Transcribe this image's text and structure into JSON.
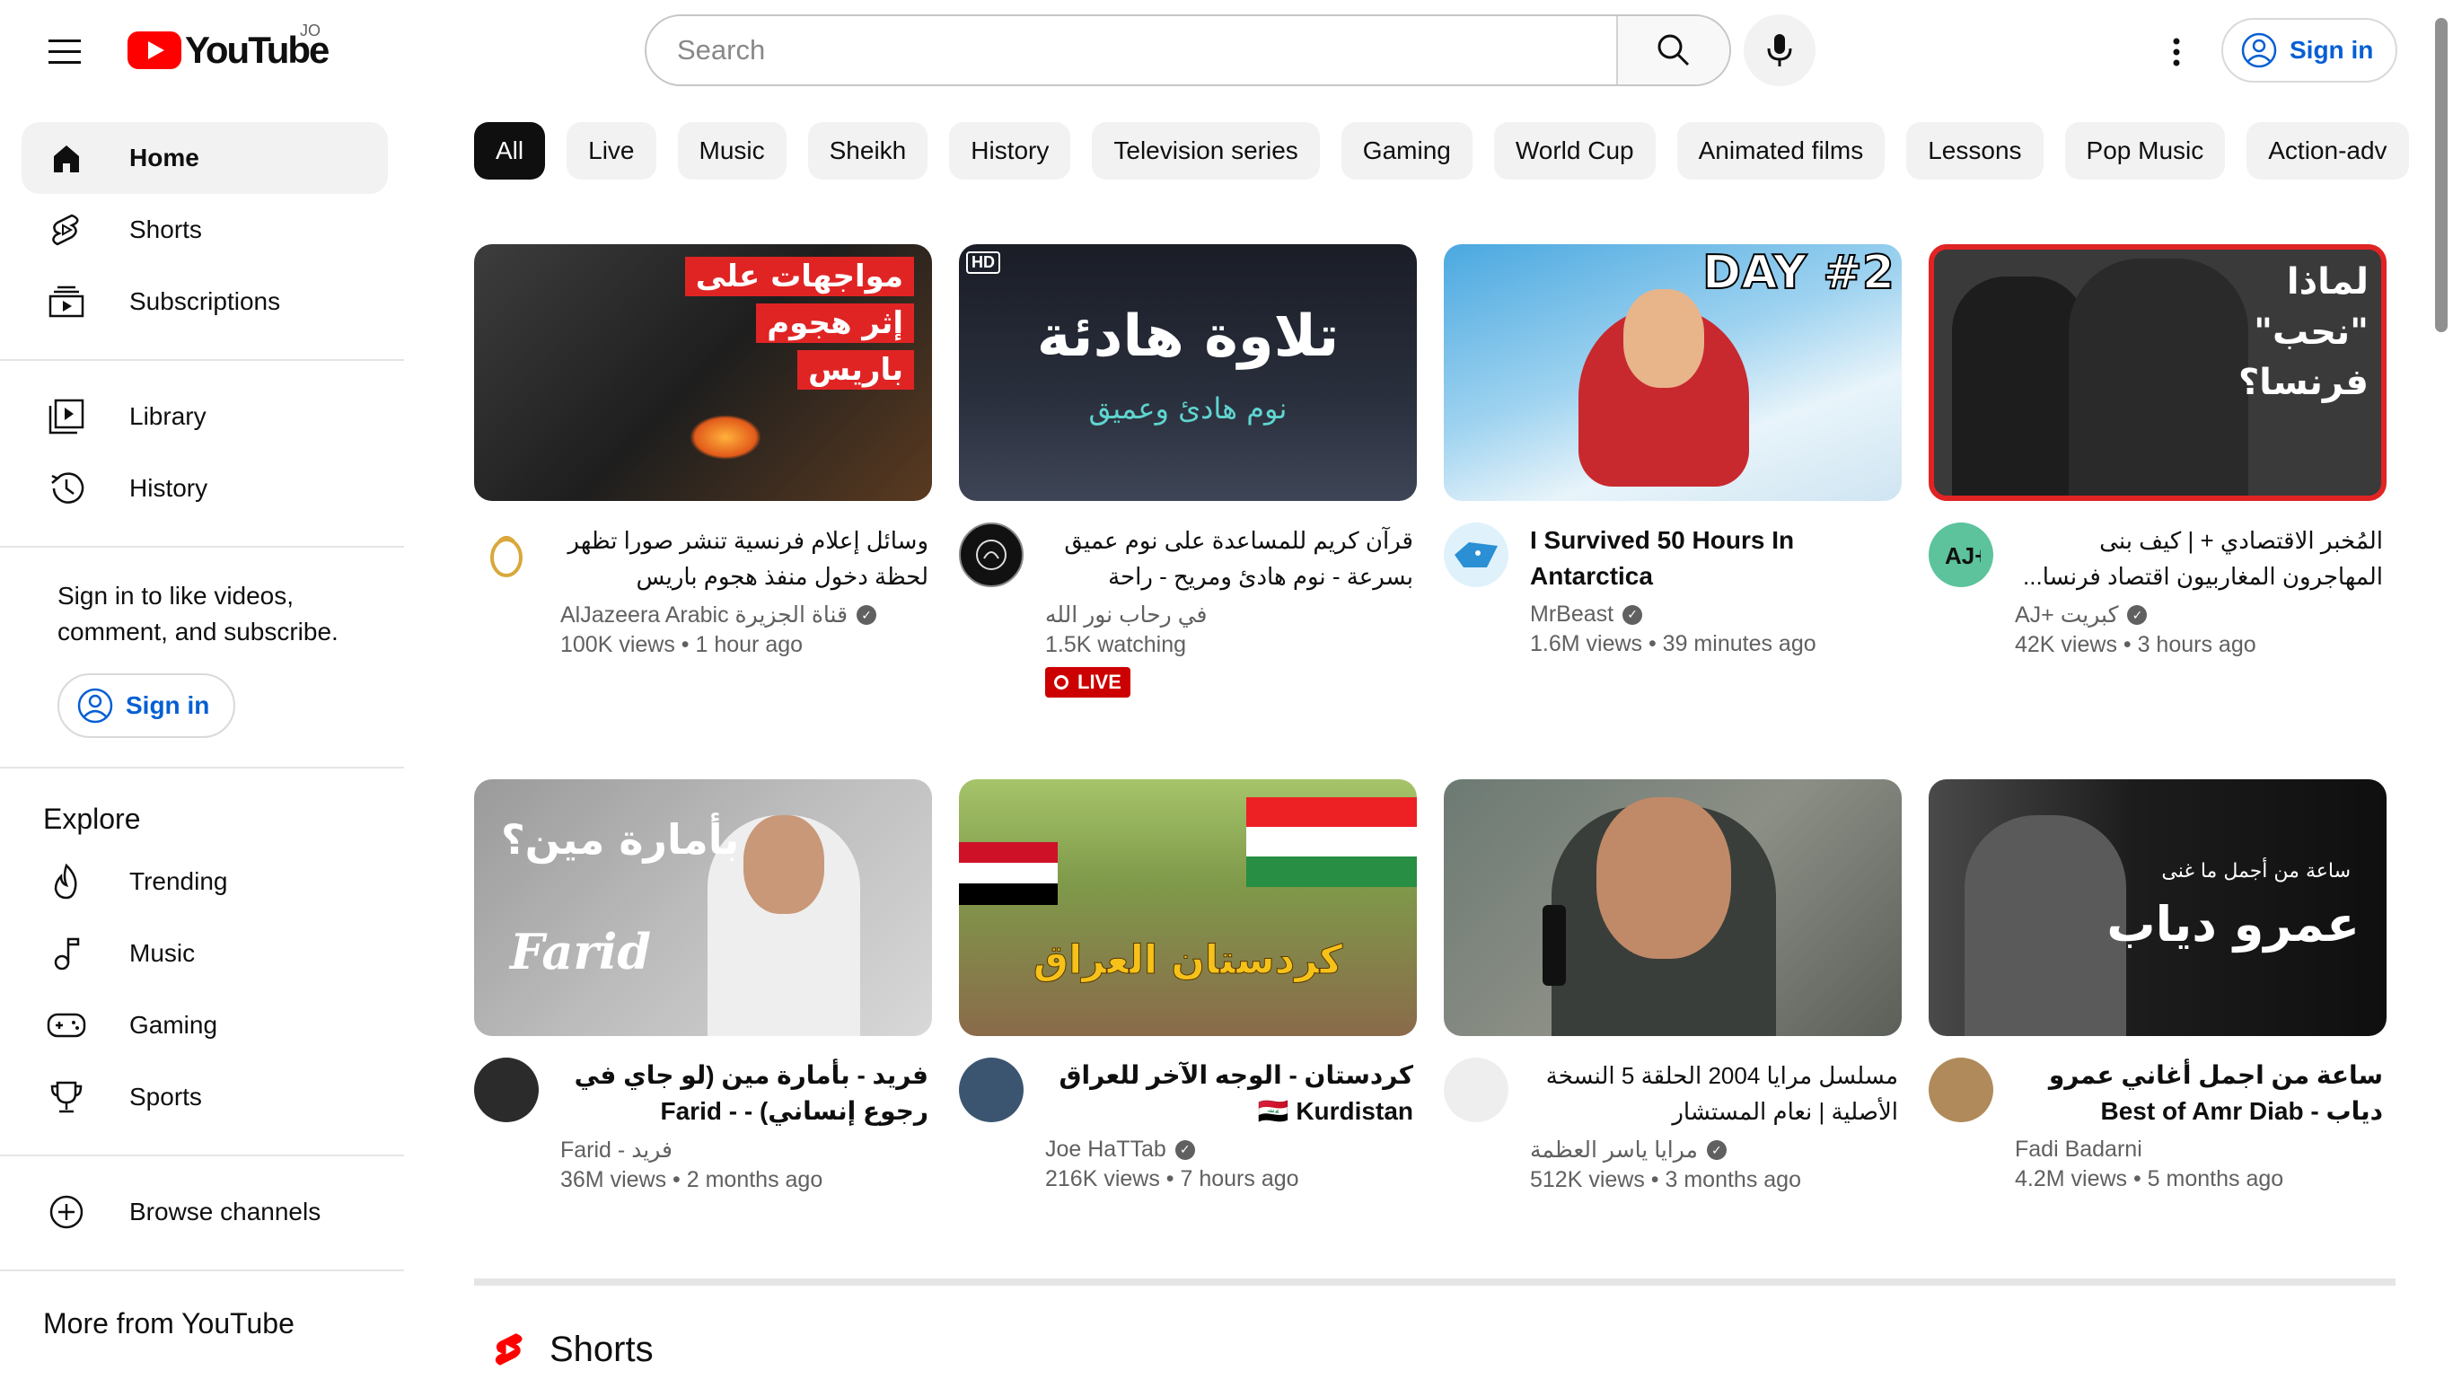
{
  "header": {
    "logo_text": "YouTube",
    "region": "JO",
    "search_placeholder": "Search",
    "signin_label": "Sign in"
  },
  "sidebar": {
    "primary": [
      {
        "label": "Home",
        "icon": "home-icon"
      },
      {
        "label": "Shorts",
        "icon": "shorts-icon"
      },
      {
        "label": "Subscriptions",
        "icon": "subscriptions-icon"
      }
    ],
    "secondary": [
      {
        "label": "Library",
        "icon": "library-icon"
      },
      {
        "label": "History",
        "icon": "history-icon"
      }
    ],
    "signin_prompt": "Sign in to like videos, comment, and subscribe.",
    "signin_label": "Sign in",
    "explore_heading": "Explore",
    "explore": [
      {
        "label": "Trending",
        "icon": "trending-icon"
      },
      {
        "label": "Music",
        "icon": "music-icon"
      },
      {
        "label": "Gaming",
        "icon": "gaming-icon"
      },
      {
        "label": "Sports",
        "icon": "sports-icon"
      }
    ],
    "browse_channels": "Browse channels",
    "more_heading": "More from YouTube"
  },
  "chips": [
    "All",
    "Live",
    "Music",
    "Sheikh",
    "History",
    "Television series",
    "Gaming",
    "World Cup",
    "Animated films",
    "Lessons",
    "Pop Music",
    "Action-adv"
  ],
  "videos": [
    {
      "title": "وسائل إعلام فرنسية تنشر صورا تظهر لحظة دخول منفذ هجوم باريس صالون...",
      "channel": "AlJazeera Arabic قناة الجزيرة",
      "verified": true,
      "stats": "100K views • 1 hour ago",
      "thumb_text": [
        "مواجهات على",
        "إثر هجوم",
        "باريس"
      ]
    },
    {
      "title": "قرآن كريم للمساعدة على نوم عميق بسرعة - نوم هادئ ومريح - راحة نفسية...",
      "channel": "في رحاب نور الله",
      "verified": false,
      "stats": "1.5K watching",
      "live": "LIVE",
      "thumb_text": [
        "تلاوة هادئة",
        "نوم هادئ وعميق",
        "HD"
      ]
    },
    {
      "title": "I Survived 50 Hours In Antarctica",
      "channel": "MrBeast",
      "verified": true,
      "stats": "1.6M views • 39 minutes ago",
      "thumb_text": [
        "DAY #2"
      ]
    },
    {
      "title": "المُخبر الاقتصادي + | كيف بنى المهاجرون المغاربيون اقتصاد فرنسا...",
      "channel": "AJ+ كبريت",
      "verified": true,
      "stats": "42K views • 3 hours ago",
      "thumb_text": [
        "لماذا",
        "\"نحب\"",
        "فرنسا؟"
      ]
    },
    {
      "title": "فريد - بأمارة مين (لو جاي في رجوع إنساني) - Farid - be'amart meen",
      "channel": "Farid - فريد",
      "verified": false,
      "stats": "36M views • 2 months ago",
      "thumb_text": [
        "بأمارة مين؟",
        "Farid"
      ]
    },
    {
      "title": "كردستان - الوجه الآخر للعراق 🇮🇶 Kurdistan",
      "channel": "Joe HaTTab",
      "verified": true,
      "stats": "216K views • 7 hours ago",
      "thumb_text": [
        "كردستان العراق"
      ]
    },
    {
      "title": "مسلسل مرايا 2004 الحلقة 5 النسخة الأصلية | نعام المستشار",
      "channel": "مرايا ياسر العظمة",
      "verified": true,
      "stats": "512K views • 3 months ago",
      "thumb_text": []
    },
    {
      "title": "ساعة من اجمل أغاني عمرو دياب - Best of Amr Diab (original)",
      "channel": "Fadi Badarni",
      "verified": false,
      "stats": "4.2M views • 5 months ago",
      "thumb_text": [
        "ساعة من أجمل ما غنى",
        "عمرو دياب"
      ]
    }
  ],
  "shorts_heading": "Shorts",
  "colors": {
    "brand_red": "#ff0000",
    "link_blue": "#065fd4",
    "live_red": "#cc0000"
  }
}
